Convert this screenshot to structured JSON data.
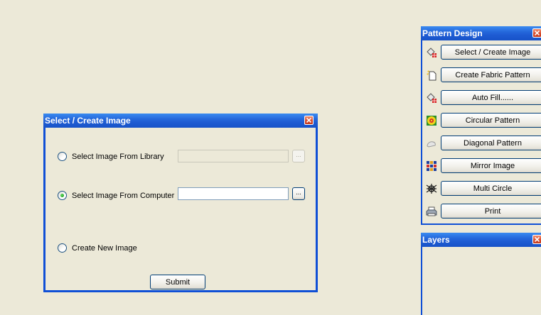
{
  "dialog": {
    "title": "Select / Create Image",
    "options": [
      {
        "label": "Select Image From Library",
        "checked": false
      },
      {
        "label": "Select Image From Computer",
        "checked": true
      },
      {
        "label": "Create New Image",
        "checked": false
      }
    ],
    "library_path_value": "",
    "computer_path_value": "",
    "browse_label": "...",
    "submit_label": "Submit"
  },
  "pattern_panel": {
    "title": "Pattern Design",
    "tools": [
      {
        "label": "Select / Create Image",
        "icon": "paint-bucket-icon"
      },
      {
        "label": "Create Fabric Pattern",
        "icon": "new-document-icon"
      },
      {
        "label": "Auto Fill......",
        "icon": "paint-bucket-icon"
      },
      {
        "label": "Circular Pattern",
        "icon": "circular-pattern-icon"
      },
      {
        "label": "Diagonal Pattern",
        "icon": "diagonal-pattern-icon"
      },
      {
        "label": "Mirror Image",
        "icon": "mirror-image-icon"
      },
      {
        "label": "Multi Circle",
        "icon": "multi-circle-icon"
      },
      {
        "label": "Print",
        "icon": "printer-icon"
      }
    ]
  },
  "layers_panel": {
    "title": "Layers"
  },
  "colors": {
    "titlebar": "#1F5CD3",
    "window_border": "#0F4FD6",
    "background": "#ECE9D8",
    "close_button": "#D6492A"
  }
}
